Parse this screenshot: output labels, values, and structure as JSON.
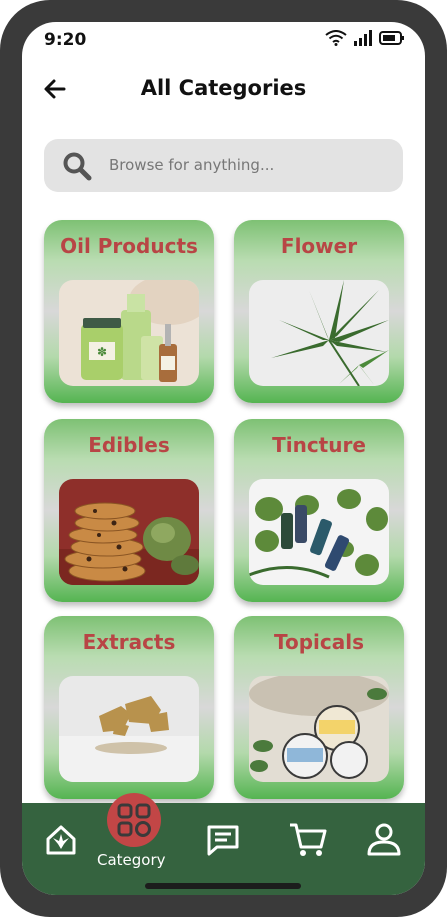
{
  "status_bar": {
    "time": "9:20"
  },
  "header": {
    "title": "All Categories"
  },
  "search": {
    "placeholder": "Browse for anything..."
  },
  "categories": [
    {
      "label": "Oil Products"
    },
    {
      "label": "Flower"
    },
    {
      "label": "Edibles"
    },
    {
      "label": "Tincture"
    },
    {
      "label": "Extracts"
    },
    {
      "label": "Topicals"
    }
  ],
  "nav": {
    "items": [
      {
        "icon": "home-icon"
      },
      {
        "icon": "category-icon",
        "label": "Category"
      },
      {
        "icon": "chat-icon"
      },
      {
        "icon": "cart-icon"
      },
      {
        "icon": "profile-icon"
      }
    ]
  },
  "colors": {
    "accent_red": "#c24646",
    "label_red": "#b84545",
    "nav_green": "#35633f",
    "card_green": "#55b451"
  }
}
